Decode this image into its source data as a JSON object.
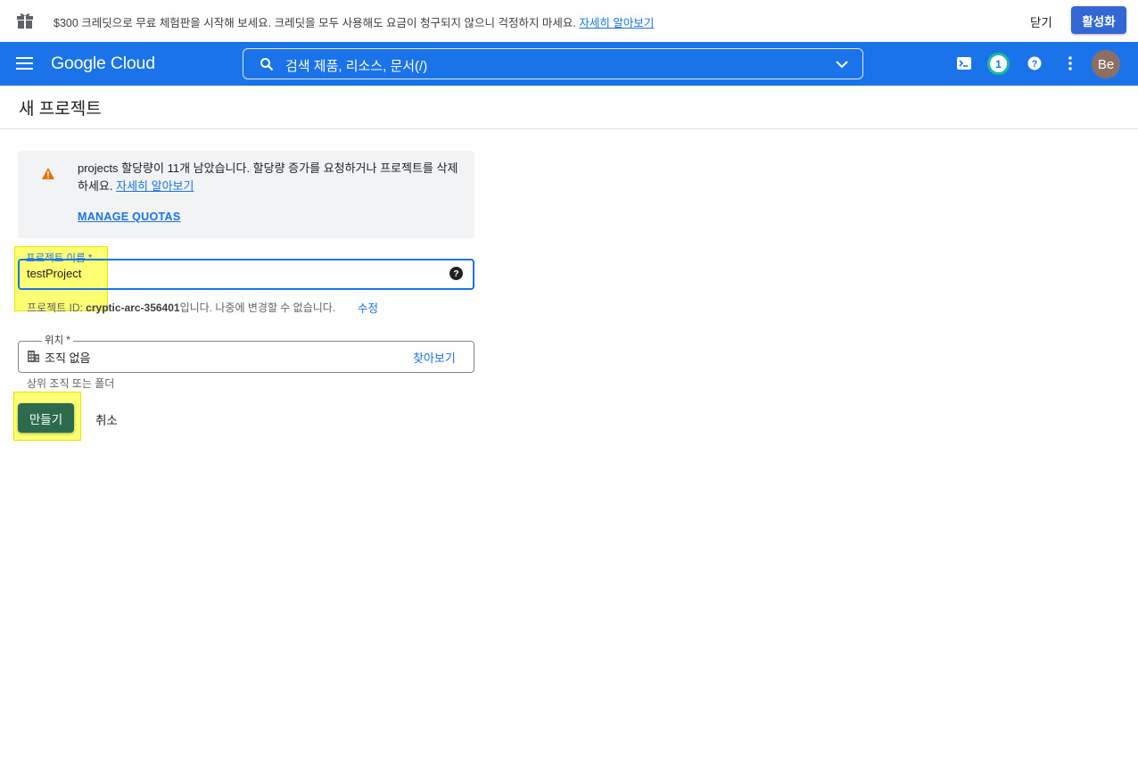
{
  "promo": {
    "text": "$300 크레딧으로 무료 체험판을 시작해 보세요. 크레딧을 모두 사용해도 요금이 청구되지 않으니 걱정하지 마세요.",
    "link": "자세히 알아보기",
    "close_label": "닫기",
    "activate_label": "활성화"
  },
  "topbar": {
    "brand": "Google Cloud",
    "search_label": "검색   제품, 리소스, 문서(/)",
    "notification_count": "1",
    "avatar_initials": "Be",
    "color": "#1a73e8"
  },
  "page": {
    "title": "새 프로젝트"
  },
  "notice": {
    "text": "projects 할당량이 11개 남았습니다. 할당량 증가를 요청하거나 프로젝트를 삭제하세요.",
    "link": "자세히 알아보기",
    "manage_label": "MANAGE QUOTAS"
  },
  "form": {
    "name_label": "프로젝트 이름 *",
    "name_value": "testProject",
    "help_icon": "?",
    "project_id_prefix": "프로젝트 ID: ",
    "project_id": "cryptic-arc-356401",
    "project_id_suffix": "입니다. 나중에 변경할 수 없습니다.",
    "edit_label": "수정",
    "location_label": "위치 *",
    "location_value": "조직 없음",
    "browse_label": "찾아보기",
    "location_hint": "상위 조직 또는 폴더"
  },
  "actions": {
    "create_label": "만들기",
    "cancel_label": "취소",
    "create_color": "#2d6b4f"
  }
}
